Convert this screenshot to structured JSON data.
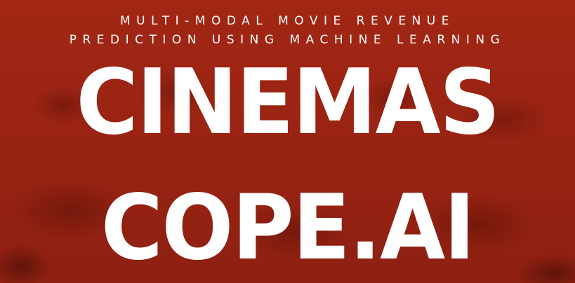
{
  "banner": {
    "background_color": "#9c2414",
    "text_color": "#ffffff",
    "subtitle": {
      "line1": "MULTI-MODAL MOVIE REVENUE",
      "line2": "PREDICTION USING MACHINE LEARNING"
    },
    "title": {
      "line1": "CINEMAS",
      "line2": "COPE.AI"
    }
  }
}
